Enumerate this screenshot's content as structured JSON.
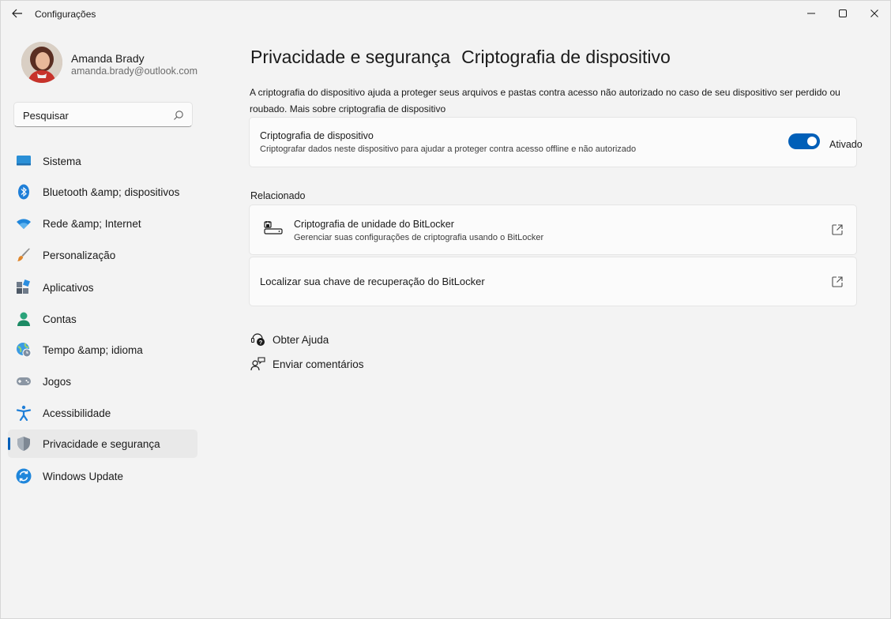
{
  "window": {
    "title": "Configurações"
  },
  "user": {
    "name": "Amanda Brady",
    "email": "amanda.brady@outlook.com"
  },
  "search": {
    "placeholder": "Pesquisar"
  },
  "sidebar": {
    "items": [
      {
        "label": "Sistema",
        "icon": "monitor-icon"
      },
      {
        "label": "Bluetooth &amp; dispositivos",
        "icon": "bluetooth-icon"
      },
      {
        "label": "Rede &amp; Internet",
        "icon": "wifi-icon"
      },
      {
        "label": "Personalização",
        "icon": "brush-icon"
      },
      {
        "label": "Aplicativos",
        "icon": "apps-icon"
      },
      {
        "label": "Contas",
        "icon": "person-icon"
      },
      {
        "label": "Tempo &amp; idioma",
        "icon": "globe-clock-icon"
      },
      {
        "label": "Jogos",
        "icon": "gamepad-icon"
      },
      {
        "label": "Acessibilidade",
        "icon": "accessibility-icon"
      },
      {
        "label": "Privacidade e segurança",
        "icon": "shield-icon",
        "selected": true
      },
      {
        "label": "Windows Update",
        "icon": "update-icon"
      }
    ]
  },
  "breadcrumb": {
    "parent": "Privacidade e segurança",
    "current": "Criptografia de dispositivo"
  },
  "description": "A criptografia do dispositivo ajuda a proteger seus arquivos e pastas contra acesso não autorizado no caso de seu dispositivo ser perdido ou roubado. Mais sobre criptografia de dispositivo",
  "encryption_card": {
    "title": "Criptografia de dispositivo",
    "subtitle": "Criptografar dados neste dispositivo para ajudar a proteger contra acesso offline e não autorizado",
    "toggle_state": "Ativado",
    "toggle_on": true
  },
  "related": {
    "heading": "Relacionado",
    "bitlocker": {
      "title": "Criptografia de unidade do BitLocker",
      "subtitle": "Gerenciar suas configurações de criptografia usando o BitLocker"
    },
    "recovery_key": {
      "title": "Localizar sua chave de recuperação do BitLocker"
    }
  },
  "help": {
    "get_help": "Obter Ajuda",
    "feedback": "Enviar comentários"
  },
  "colors": {
    "accent": "#005fb8",
    "background": "#f3f3f3",
    "card": "#fbfbfb"
  }
}
